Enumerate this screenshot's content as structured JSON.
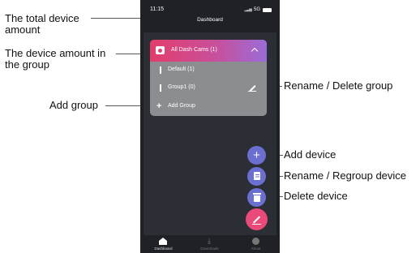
{
  "status_bar": {
    "time": "11:15",
    "network": "5G"
  },
  "nav": {
    "title": "Dashboard"
  },
  "group_panel": {
    "header_label": "All Dash Cams (1)",
    "groups": [
      {
        "label": "Default (1)"
      },
      {
        "label": "Group1 (0)"
      }
    ],
    "add_group_label": "Add Group"
  },
  "tab_bar": {
    "dashboard": "Dashboard",
    "downloads": "Downloads",
    "about": "About"
  },
  "callouts": {
    "total_line1": "The total device",
    "total_line2": "amount",
    "group_line1": "The device amount in",
    "group_line2": "the group",
    "add_group": "Add group",
    "rename_delete_group": "Rename / Delete group",
    "add_device": "Add device",
    "rename_regroup_device": "Rename / Regroup device",
    "delete_device": "Delete device"
  },
  "colors": {
    "header_gradient": [
      "#e23d6c",
      "#9b6cd8"
    ],
    "fab_primary": "#6b6fd0",
    "fab_accent": "#e94a79",
    "callout_dot_blue": "#2f6fe0",
    "callout_dot_pink": "#e0426f"
  }
}
